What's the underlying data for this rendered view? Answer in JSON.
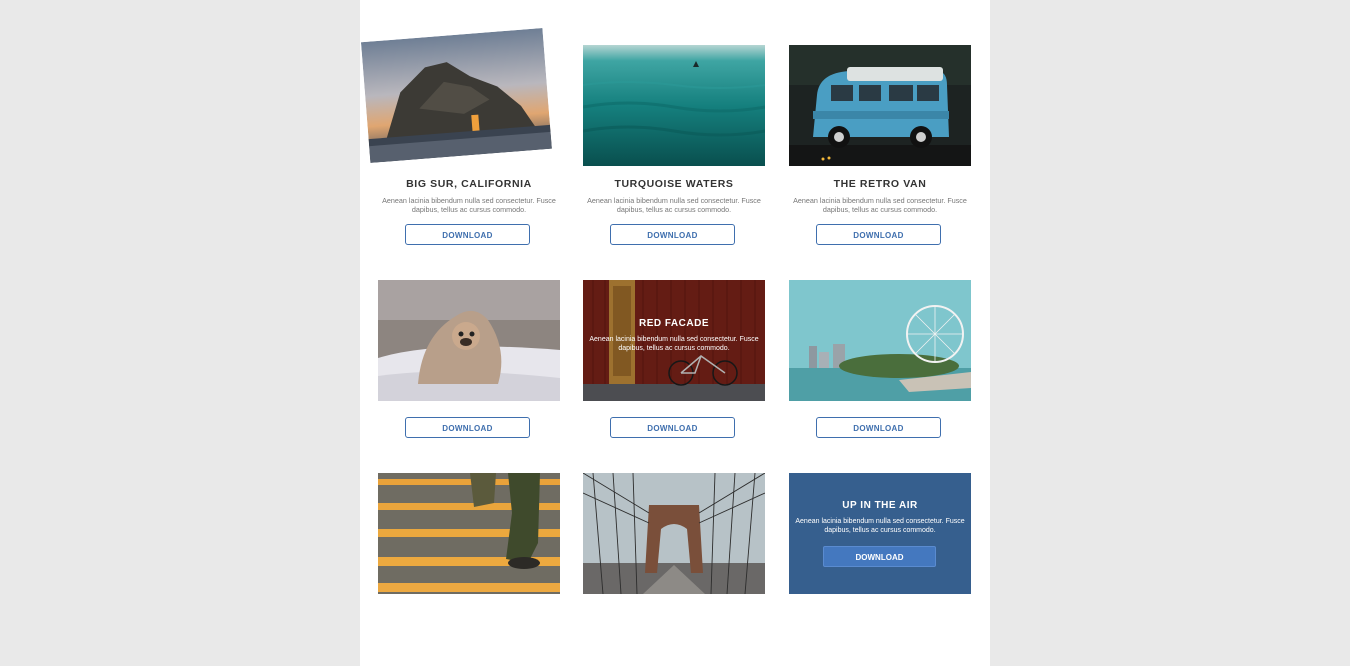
{
  "cards": [
    {
      "title": "BIG SUR, CALIFORNIA",
      "description": "Aenean lacinia bibendum nulla sed consectetur. Fusce dapibus, tellus ac cursus commodo.",
      "button": "DOWNLOAD",
      "image": "rocky-coast-sunset"
    },
    {
      "title": "TURQUOISE WATERS",
      "description": "Aenean lacinia bibendum nulla sed consectetur. Fusce dapibus, tellus ac cursus commodo.",
      "button": "DOWNLOAD",
      "image": "turquoise-ocean"
    },
    {
      "title": "THE RETRO VAN",
      "description": "Aenean lacinia bibendum nulla sed consectetur. Fusce dapibus, tellus ac cursus commodo.",
      "button": "DOWNLOAD",
      "image": "blue-retro-van"
    },
    {
      "button": "DOWNLOAD",
      "image": "pug-in-blanket"
    },
    {
      "title": "RED FACADE",
      "description": "Aenean lacinia bibendum nulla sed consectetur. Fusce dapibus, tellus ac cursus commodo.",
      "button": "DOWNLOAD",
      "image": "red-facade-bicycle"
    },
    {
      "button": "DOWNLOAD",
      "image": "ferris-wheel-river"
    },
    {
      "image": "stairs-walking"
    },
    {
      "image": "suspension-bridge"
    },
    {
      "title": "UP IN THE AIR",
      "description": "Aenean lacinia bibendum nulla sed consectetur. Fusce dapibus, tellus ac cursus commodo.",
      "button": "DOWNLOAD"
    }
  ],
  "colors": {
    "page_background": "#e9e9e9",
    "content_background": "#ffffff",
    "accent": "#3f6fae",
    "tile_blue": "#365f8e"
  }
}
